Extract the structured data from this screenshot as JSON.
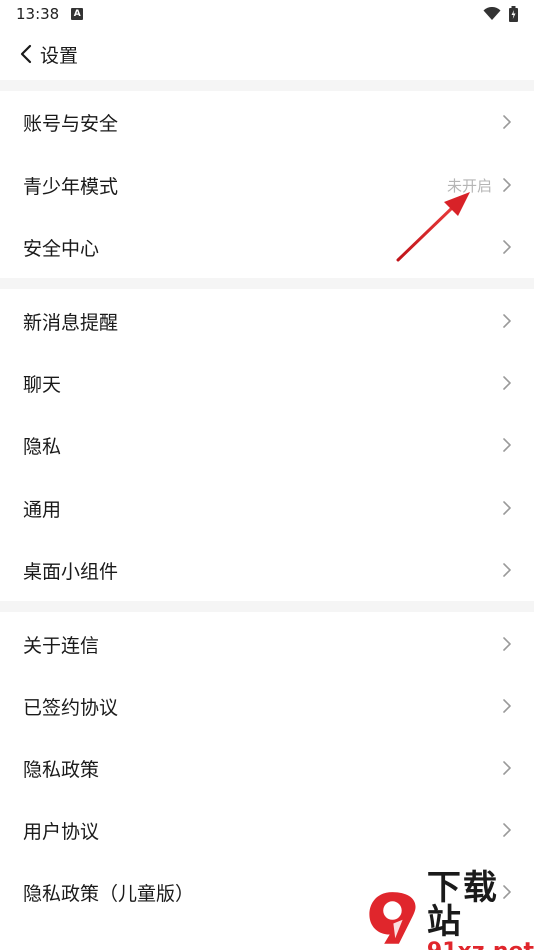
{
  "status_bar": {
    "time": "13:38",
    "notif_glyph": "A"
  },
  "header": {
    "title": "设置"
  },
  "groups": [
    {
      "items": [
        {
          "label": "账号与安全"
        },
        {
          "label": "青少年模式",
          "status": "未开启"
        },
        {
          "label": "安全中心"
        }
      ]
    },
    {
      "items": [
        {
          "label": "新消息提醒"
        },
        {
          "label": "聊天"
        },
        {
          "label": "隐私"
        },
        {
          "label": "通用"
        },
        {
          "label": "桌面小组件"
        }
      ]
    },
    {
      "items": [
        {
          "label": "关于连信"
        },
        {
          "label": "已签约协议"
        },
        {
          "label": "隐私政策"
        },
        {
          "label": "用户协议"
        },
        {
          "label": "隐私政策（儿童版）"
        }
      ]
    }
  ],
  "icons": {
    "back": "chevron-left-icon",
    "row_arrow": "chevron-right-icon",
    "wifi": "wifi-icon",
    "battery": "battery-icon"
  },
  "watermark": {
    "brand": "下载站",
    "url": "91xz.net"
  },
  "colors": {
    "accent_red": "#e0262c",
    "divider_gray": "#f5f5f5",
    "status_gray": "#b5b5b5"
  }
}
